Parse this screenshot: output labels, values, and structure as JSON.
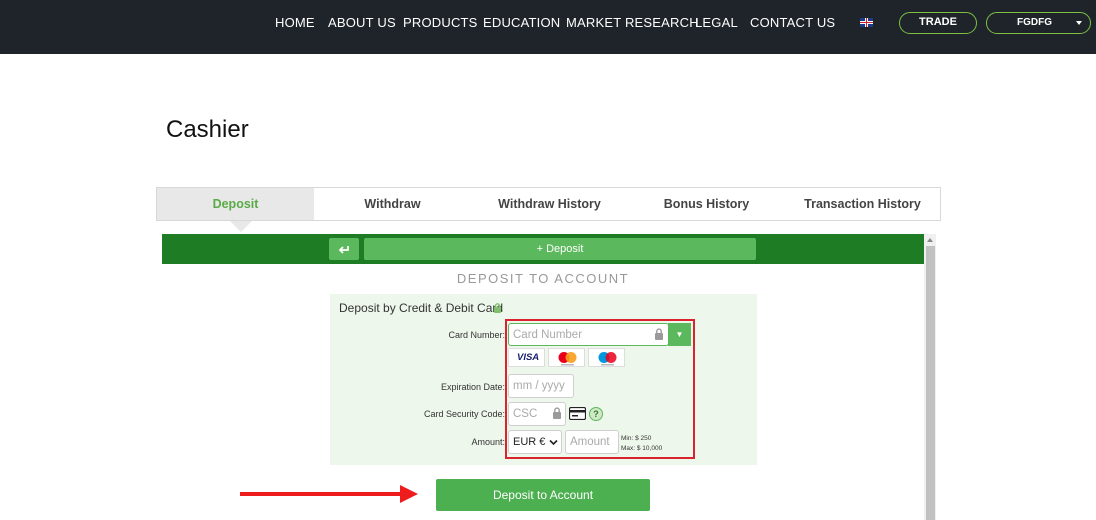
{
  "nav": {
    "items": [
      "HOME",
      "ABOUT US",
      "PRODUCTS",
      "EDUCATION",
      "MARKET RESEARCH",
      "LEGAL",
      "CONTACT US"
    ],
    "language_icon": "uk-flag-icon",
    "trade_label": "TRADE",
    "user_label": "FGDFG"
  },
  "page": {
    "title": "Cashier"
  },
  "tabs": [
    {
      "label": "Deposit",
      "active": true
    },
    {
      "label": "Withdraw",
      "active": false
    },
    {
      "label": "Withdraw History",
      "active": false
    },
    {
      "label": "Bonus History",
      "active": false
    },
    {
      "label": "Transaction History",
      "active": false
    }
  ],
  "toolbar": {
    "back_icon": "return-arrow-icon",
    "deposit_label": "+ Deposit"
  },
  "deposit": {
    "heading": "DEPOSIT TO ACCOUNT",
    "panel_title": "Deposit by Credit & Debit Card",
    "card_number_label": "Card Number:",
    "card_number_placeholder": "Card Number",
    "card_logos": [
      "VISA",
      "Mastercard",
      "Maestro"
    ],
    "visa_text": "VISA",
    "expiration_label": "Expiration Date:",
    "expiration_placeholder": "mm / yyyy",
    "csc_label": "Card Security Code:",
    "csc_placeholder": "CSC",
    "help_text": "?",
    "amount_label": "Amount:",
    "currency": "EUR €",
    "amount_placeholder": "Amount",
    "min_text": "Min: $ 250",
    "max_text": "Max: $ 10,000",
    "submit_label": "Deposit to Account"
  },
  "colors": {
    "accent": "#5cb85c",
    "dark_green": "#1e7d24",
    "nav_bg": "#1e2429",
    "highlight": "#d9232d"
  }
}
